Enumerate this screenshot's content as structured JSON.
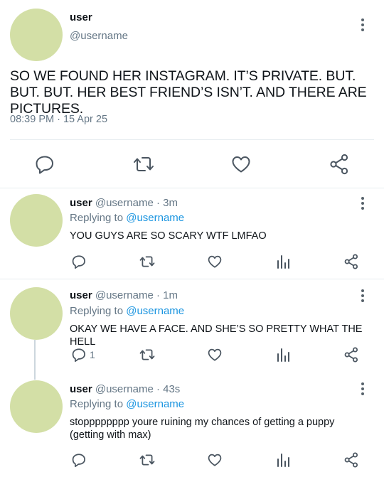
{
  "main_tweet": {
    "name": "user",
    "handle": "@username",
    "text": "SO WE FOUND HER INSTAGRAM. IT’S PRIVATE. BUT. BUT. BUT. HER BEST FRIEND’S ISN’T. AND THERE ARE PICTURES.",
    "timestamp": "08:39 PM · 15 Apr 25"
  },
  "replies": [
    {
      "name": "user",
      "handle_time": "@username · 3m",
      "replying_prefix": "Replying to ",
      "replying_to": "@username",
      "text": "YOU GUYS ARE SO SCARY WTF LMFAO",
      "reply_count": ""
    },
    {
      "name": "user",
      "handle_time": "@username · 1m",
      "replying_prefix": "Replying to ",
      "replying_to": "@username",
      "text": "OKAY WE HAVE A FACE. AND SHE’S SO PRETTY WHAT THE HELL",
      "reply_count": "1"
    },
    {
      "name": "user",
      "handle_time": "@username · 43s",
      "replying_prefix": "Replying to ",
      "replying_to": "@username",
      "text": "stopppppppp youre ruining my chances of getting a puppy (getting with max)",
      "reply_count": ""
    }
  ],
  "colors": {
    "avatar": "#d3dfa6",
    "icon": "#4a5560",
    "link": "#1b95e0",
    "divider": "#e6ecf0"
  },
  "icons": [
    "reply-icon",
    "retweet-icon",
    "like-icon",
    "share-icon",
    "analytics-icon",
    "more-icon"
  ]
}
